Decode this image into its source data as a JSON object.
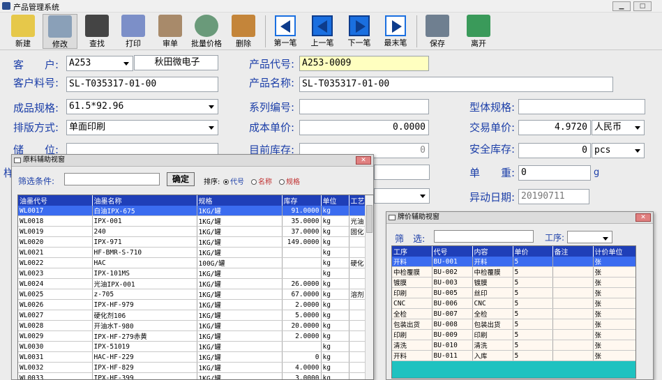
{
  "window": {
    "title": "产品管理系统"
  },
  "toolbar": {
    "buttons": [
      "新建",
      "修改",
      "查找",
      "打印",
      "审单",
      "批量价格",
      "删除",
      "第一笔",
      "上一笔",
      "下一笔",
      "最末笔",
      "保存",
      "离开"
    ]
  },
  "form": {
    "customer_label": "客　　户:",
    "customer_code": "A253",
    "customer_name": "秋田微电子",
    "cust_part_label": "客户料号:",
    "cust_part": "SL-T035317-01-00",
    "product_code_label": "产品代号:",
    "product_code": "A253-0009",
    "product_name_label": "产品名称:",
    "product_name": "SL-T035317-01-00",
    "spec_label": "成品规格:",
    "spec": "61.5*92.96",
    "series_label": "系列编号:",
    "series": "",
    "model_spec_label": "型体规格:",
    "model_spec": "",
    "layout_label": "排版方式:",
    "layout": "单面印刷",
    "cost_label": "成本单价:",
    "cost": "0.0000",
    "trade_label": "交易单价:",
    "trade_price": "4.9720",
    "currency": "人民币",
    "storage_label": "储　　位:",
    "stock_label": "目前库存:",
    "stock": "0",
    "safety_label": "安全库存:",
    "safety": "0",
    "safety_unit": "pcs",
    "weight_label": "单　　重:",
    "weight": "0",
    "weight_unit": "g",
    "change_label": "异动日期:",
    "change_date": "20190711",
    "sample_label_partial": "样"
  },
  "ink_dialog": {
    "title": "原料辅助视窗",
    "filter_label": "筛选条件:",
    "ok": "确定",
    "sort_label": "排序:",
    "sort_options": [
      "代号",
      "名称",
      "规格"
    ],
    "columns": [
      "油墨代号",
      "油墨名称",
      "规格",
      "库存",
      "单位",
      "工艺"
    ],
    "rows": [
      [
        "WL0017",
        "白油IPX-675",
        "1KG/罐",
        "91.0000",
        "kg",
        ""
      ],
      [
        "WL0018",
        "IPX-001",
        "1KG/罐",
        "35.0000",
        "kg",
        "光油"
      ],
      [
        "WL0019",
        "240",
        "1KG/罐",
        "37.0000",
        "kg",
        "固化"
      ],
      [
        "WL0020",
        "IPX-971",
        "1KG/罐",
        "149.0000",
        "kg",
        ""
      ],
      [
        "WL0021",
        "HF-BMR-S-710",
        "1KG/罐",
        "",
        "kg",
        ""
      ],
      [
        "WL0022",
        "HAC",
        "100G/罐",
        "",
        "kg",
        "硬化"
      ],
      [
        "WL0023",
        "IPX-101MS",
        "1KG/罐",
        "",
        "kg",
        ""
      ],
      [
        "WL0024",
        "光油IPX-001",
        "1KG/罐",
        "26.0000",
        "kg",
        ""
      ],
      [
        "WL0025",
        "z-705",
        "1KG/罐",
        "67.0000",
        "kg",
        "溶剂"
      ],
      [
        "WL0026",
        "IPX-HF-979",
        "1KG/罐",
        "2.0000",
        "kg",
        ""
      ],
      [
        "WL0027",
        "硬化剂106",
        "1KG/罐",
        "5.0000",
        "kg",
        ""
      ],
      [
        "WL0028",
        "开油水T-980",
        "1KG/罐",
        "20.0000",
        "kg",
        ""
      ],
      [
        "WL0029",
        "IPX-HF-279赤黄",
        "1KG/罐",
        "2.0000",
        "kg",
        ""
      ],
      [
        "WL0030",
        "IPX-51019",
        "1KG/罐",
        "",
        "kg",
        ""
      ],
      [
        "WL0031",
        "HAC-HF-229",
        "1KG/罐",
        "0",
        "kg",
        ""
      ],
      [
        "WL0032",
        "IPX-HF-829",
        "1KG/罐",
        "4.0000",
        "kg",
        ""
      ],
      [
        "WL0033",
        "IPX-HF-399",
        "1KG/罐",
        "3.0000",
        "kg",
        ""
      ]
    ]
  },
  "price_dialog": {
    "title": "牌价辅助视窗",
    "filter_label": "筛　选:",
    "process_label": "工序:",
    "columns": [
      "工序",
      "代号",
      "内容",
      "单价",
      "备注",
      "计价单位"
    ],
    "rows": [
      [
        "开料",
        "BU-001",
        "开料",
        "5",
        "",
        "张"
      ],
      [
        "中检覆膜",
        "BU-002",
        "中检覆膜",
        "5",
        "",
        "张"
      ],
      [
        "镀膜",
        "BU-003",
        "镀膜",
        "5",
        "",
        "张"
      ],
      [
        "印刷",
        "BU-005",
        "丝印",
        "5",
        "",
        "张"
      ],
      [
        "CNC",
        "BU-006",
        "CNC",
        "5",
        "",
        "张"
      ],
      [
        "全检",
        "BU-007",
        "全检",
        "5",
        "",
        "张"
      ],
      [
        "包装出货",
        "BU-008",
        "包装出货",
        "5",
        "",
        "张"
      ],
      [
        "印刷",
        "BU-009",
        "印刷",
        "5",
        "",
        "张"
      ],
      [
        "清洗",
        "BU-010",
        "清洗",
        "5",
        "",
        "张"
      ],
      [
        "开料",
        "BU-011",
        "入库",
        "5",
        "",
        "张"
      ]
    ]
  }
}
